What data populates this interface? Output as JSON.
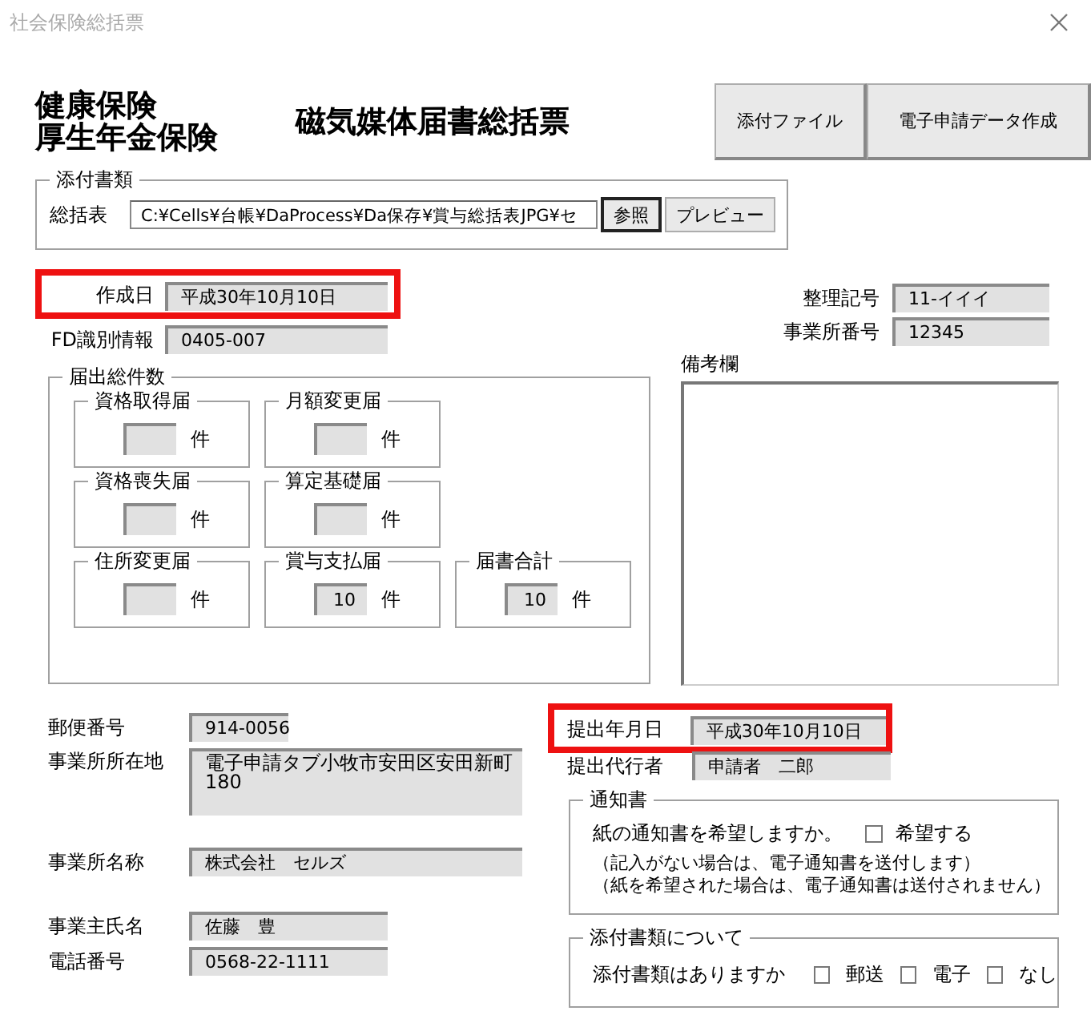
{
  "window": {
    "title": "社会保険総括票"
  },
  "header": {
    "insurance_lines": [
      "健康保険",
      "厚生年金保険"
    ],
    "form_title": "磁気媒体届書総括票",
    "buttons": [
      "添付ファイル",
      "電子申請データ作成"
    ]
  },
  "attachment": {
    "legend": "添付書類",
    "label": "総括表",
    "path": "C:¥Cells¥台帳¥DaProcess¥Da保存¥賞与総括表JPG¥セ",
    "buttons": [
      {
        "label": "参照",
        "focused": true
      },
      {
        "label": "プレビュー",
        "focused": false
      }
    ]
  },
  "created": {
    "label": "作成日",
    "value": "平成30年10月10日",
    "highlighted": true
  },
  "fd_id": {
    "label": "FD識別情報",
    "value": "0405-007"
  },
  "counts": {
    "legend": "届出総件数",
    "rows": [
      [
        {
          "title": "資格取得届",
          "unit": "件"
        },
        {
          "title": "月額変更届",
          "unit": "件"
        }
      ],
      [
        {
          "title": "資格喪失届",
          "unit": "件"
        },
        {
          "title": "算定基礎届",
          "unit": "件"
        }
      ],
      [
        {
          "title": "住所変更届",
          "unit": "件"
        },
        {
          "title": "賞与支払届",
          "value": "10",
          "unit": "件"
        },
        {
          "title": "届書合計",
          "value": "10",
          "unit": "件"
        }
      ]
    ]
  },
  "reference_no": {
    "label": "整理記号",
    "value": "11-イイイ"
  },
  "office_no": {
    "label": "事業所番号",
    "value": "12345"
  },
  "remarks": {
    "label": "備考欄"
  },
  "postal": {
    "label": "郵便番号",
    "value": "914-0056"
  },
  "address": {
    "label": "事業所所在地",
    "lines": [
      "電子申請タブ小牧市安田区安田新町",
      "180"
    ]
  },
  "office_name": {
    "label": "事業所名称",
    "value": "株式会社　セルズ"
  },
  "owner": {
    "label": "事業主氏名",
    "value": "佐藤　豊"
  },
  "phone": {
    "label": "電話番号",
    "value": "0568-22-1111"
  },
  "submitted": {
    "label": "提出年月日",
    "value": "平成30年10月10日",
    "highlighted": true
  },
  "agent": {
    "label": "提出代行者",
    "value": "申請者　二郎"
  },
  "notice": {
    "legend": "通知書",
    "question": "紙の通知書を希望しますか。",
    "checkbox": {
      "label": "希望する",
      "checked": false
    },
    "notes": [
      "（記入がない場合は、電子通知書を送付します）",
      "（紙を希望された場合は、電子通知書は送付されません）"
    ]
  },
  "attachments_info": {
    "legend": "添付書類について",
    "question": "添付書類はありますか",
    "options": [
      {
        "label": "郵送",
        "checked": false
      },
      {
        "label": "電子",
        "checked": false
      },
      {
        "label": "なし",
        "checked": false
      }
    ]
  }
}
